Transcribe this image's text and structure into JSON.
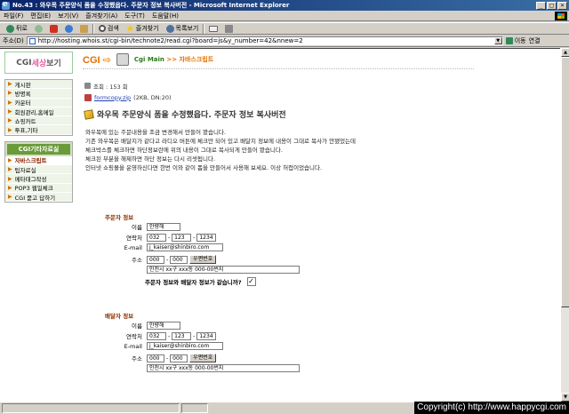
{
  "window": {
    "title": "No.43 : 와우목 주문양식 폼을 수정했읍다. 주문자 정보 복사버전 - Microsoft Internet Explorer",
    "buttons": [
      "_",
      "□",
      "×"
    ]
  },
  "menu": [
    "파일(F)",
    "편집(E)",
    "보기(V)",
    "즐겨찾기(A)",
    "도구(T)",
    "도움말(H)"
  ],
  "toolbar": {
    "back": "뒤로",
    "forward": "→",
    "search": "검색",
    "favorites": "즐겨찾기",
    "history": "목록보기"
  },
  "address": {
    "label": "주소(D)",
    "url": "http://hosting.whois.st/cgi-bin/technote2/read.cgi?board=js&y_number=42&nnew=2",
    "go": "이동",
    "links": "연결"
  },
  "sidebar": {
    "logo": [
      "CGI",
      "세상",
      "보기"
    ],
    "group1": [
      "게시판",
      "방명록",
      "카운터",
      "회원관리,홈메일",
      "쇼핑카트",
      "투표,기타"
    ],
    "group2_title": "CGI기타자료실",
    "group2": [
      "자바스크립트",
      "팁자료실",
      "메타태그작성",
      "POP3 웹일체크",
      "CGI 묻고 답하기"
    ],
    "active_index": 0
  },
  "header": {
    "logo": "CGI",
    "crumb_main": "Cgi Main",
    "crumb_sep": ">>",
    "crumb_page": "자바스크립트"
  },
  "post": {
    "views_label": "조회 : 153 회",
    "attachment": "formcopy.zip",
    "attachment_meta": "(2KB, DN:20)",
    "title": "와우목 주문양식 폼을 수정했읍다. 주문자 정보 복사버전",
    "body": [
      "와우목에 있는 주문내용을 조금 변경해서 만들어 봤습니다.",
      "기존 와우목은 배달지가 같다고 라디오 버튼에 체크만 되어 있고 배달지 정보에 내용이 그대로 복사가 안됐었는데",
      "체크박스를 체크하면 하단정보란에 위의 내용이 그대로 복사되게 만들어 봤습니다.",
      "체크된 부분을 해제하면 하단 정보는 다시 리셋됩니다.",
      "인터넷 쇼핑몰을 운영하신다면 한번 이와 같이 폼을 만들어서 사용해 보세요. 이상 허접이었습니다."
    ]
  },
  "orderer": {
    "section": "주문자 정보",
    "name_label": "이름",
    "name": "안량해",
    "phone_label": "연락처",
    "phone": [
      "032",
      "123",
      "1234"
    ],
    "email_label": "E-mail",
    "email": "j_kaiser@shinbiro.com",
    "addr_label": "주소",
    "zip": [
      "000",
      "000"
    ],
    "zip_button": "우편번호",
    "addr": "인천시 xx구 xxx동 000-00번지",
    "same_question": "주문자 정보와 배달자 정보가 같습니까?",
    "same_checked": "✓"
  },
  "receiver": {
    "section": "배달자 정보",
    "name_label": "이름",
    "name": "안량해",
    "phone_label": "연락처",
    "phone": [
      "032",
      "123",
      "1234"
    ],
    "email_label": "E-mail",
    "email": "j_kaiser@shinbiro.com",
    "addr_label": "주소",
    "zip": [
      "000",
      "000"
    ],
    "zip_button": "우편번호",
    "addr": "인천시 xx구 xxx동 000-00번지"
  },
  "overlay": {
    "copyright": "Copyright(c) http://www.happycgi.com"
  }
}
